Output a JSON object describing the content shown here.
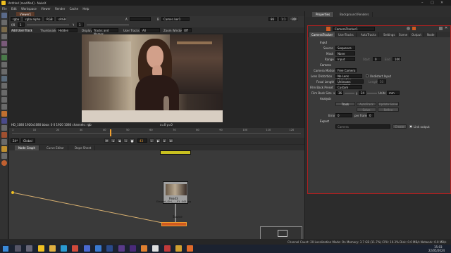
{
  "titlebar": {
    "title": "Untitled [modified] - NukeX"
  },
  "menubar": {
    "items": [
      "File",
      "Edit",
      "Workspace",
      "Viewer",
      "Render",
      "Cache",
      "Help"
    ]
  },
  "viewer_tabs": {
    "tab1": "Viewer1",
    "tab2": "Camera Tracker1"
  },
  "viewer_toolbar": {
    "channels": "rgba",
    "layer": "rgba.alpha",
    "colorspace": "RGB",
    "channel_sel": "sRGB",
    "input_a": "A",
    "input_b": "B",
    "input_b_val": "Camer..ker1",
    "zoom": "86",
    "frame_mode": "1:1",
    "proxy": "3D"
  },
  "viewer_toolbar2": {
    "gain_label": "f/8",
    "gain_val": "1",
    "gamma_label": "Y",
    "gamma_val": "1"
  },
  "overlay_bar": {
    "add_user_track": "Add User Track",
    "thumbnails_label": "Thumbnails",
    "thumbnails_val": "Hidden",
    "display_label": "Display",
    "display_val": "Tracks and Names",
    "user_tracks_label": "User Tracks",
    "user_tracks_val": "All",
    "zoom_window_label": "Zoom Window",
    "zoom_window_val": "Off"
  },
  "viewer_status": {
    "info": "HD_1080 1920x1080  bbox: 0 0 1920 1080 channels: rgb",
    "coords": "x=0 y=0"
  },
  "timeline": {
    "ticks": [
      "1",
      "10",
      "20",
      "30",
      "40",
      "50",
      "60",
      "70",
      "80",
      "90",
      "100",
      "110",
      "120"
    ],
    "fps": "24*",
    "mode": "Global",
    "frame": "43",
    "current_frame": 43,
    "first_frame": 1,
    "last_frame": 125
  },
  "panel_tabs": {
    "tab1": "Node Graph",
    "tab2": "Curve Editor",
    "tab3": "Dope Sheet"
  },
  "nodes": {
    "read_label": "Read3",
    "read_file": "Elegant_Girl_..._01..043.jpg",
    "source_label": "Source"
  },
  "properties": {
    "tab1": "Properties",
    "tab2": "Background Renders",
    "node_name": "CameraTracker1",
    "tabs": [
      "CameraTracker",
      "UserTracks",
      "AutoTracks",
      "Settings",
      "Scene",
      "Output",
      "Node"
    ],
    "section_input": "Input",
    "source_label": "Source",
    "source_val": "Sequence",
    "mask_label": "Mask",
    "mask_val": "None",
    "range_label": "Range",
    "range_val": "Input",
    "range_from_label": "Start",
    "range_from": "0",
    "range_to_label": "End",
    "range_to": "100",
    "section_camera": "Camera",
    "camera_motion_label": "Camera Motion",
    "camera_motion_val": "Free Camera",
    "lens_distortion_label": "Lens Distortion",
    "lens_distortion_val": "No Lens Distortion",
    "undistort_label": "Undistort Input",
    "focal_length_label": "Focal Length",
    "focal_length_val": "Unknown Constant",
    "length_label": "Length",
    "length_val": "50",
    "film_back_preset_label": "Film Back Preset",
    "film_back_preset_val": "Custom",
    "film_back_size_label": "Film Back Size",
    "film_back_x_label": "x",
    "film_back_x": "36",
    "film_back_y_label": "y",
    "film_back_y": "24",
    "units_label": "Units",
    "units_val": "mm",
    "section_analysis": "Analysis",
    "track_btn": "Track",
    "auto_track_btn": "AutoTrack",
    "update_solve_btn": "Update Solve",
    "solve_btn": "Solve",
    "refine_btn": "Refine",
    "error_label": "Error",
    "error_val": "0",
    "per_frame_label": "per frame",
    "per_frame_val": "0",
    "section_export": "Export",
    "export_val": "Camera",
    "create_btn": "Create",
    "link_output_label": "Link output"
  },
  "statusbar": {
    "text": "Channel Count: 20  Localization Mode: On  Memory: 3.7 GB (11.7%)  CPU: 10.3%  Disk: 0.0 MB/s  Network: 0.0 MB/s"
  },
  "taskbar": {
    "time": "15:03",
    "date": "22/05/2024"
  }
}
